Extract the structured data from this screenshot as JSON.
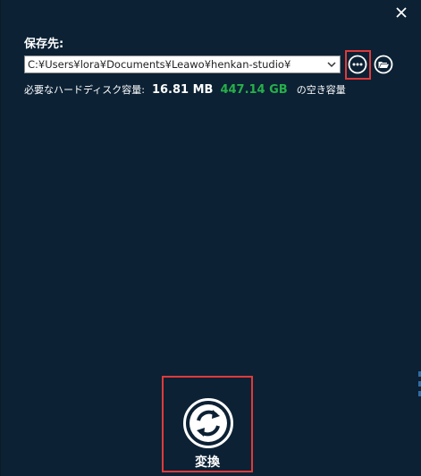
{
  "dialog": {
    "save_label": "保存先:",
    "path_value": "C:¥Users¥lora¥Documents¥Leawo¥henkan-studio¥",
    "disk": {
      "required_label": "必要なハードディスク容量:",
      "required_size": "16.81 MB",
      "free_size": "447.14 GB",
      "free_label": "の空き容量"
    },
    "convert_label": "変換"
  },
  "icons": {
    "close": "close-icon",
    "dropdown": "chevron-down-icon",
    "more": "more-options-icon",
    "folder": "open-folder-icon",
    "convert": "convert-refresh-icon"
  },
  "colors": {
    "background": "#0c2134",
    "free_space": "#27b04a",
    "highlight": "#e03a3a"
  }
}
